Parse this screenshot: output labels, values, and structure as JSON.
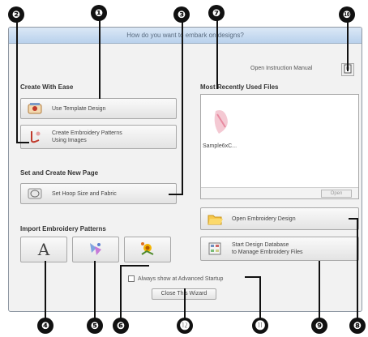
{
  "window": {
    "title": "How do you want to embark on designs?"
  },
  "left": {
    "create_with_ease": {
      "title": "Create With Ease",
      "template_button": "Use Template Design",
      "pattern_button_line1": "Create Embroidery Patterns",
      "pattern_button_line2": "Using Images"
    },
    "set_page": {
      "title": "Set and Create New Page",
      "page_button": "Set Hoop Size and Fabric"
    },
    "import": {
      "title": "Import Embroidery Patterns",
      "font_icon_glyph": "A"
    }
  },
  "right": {
    "manual_label": "Open Instruction Manual",
    "recent": {
      "title": "Most Recently Used Files",
      "files": [
        "Sample6xC..."
      ],
      "open_label": "Open"
    },
    "open_design_button": "Open Embroidery Design",
    "database_line1": "Start Design Database",
    "database_line2": "to Manage Embroidery Files"
  },
  "footer": {
    "checkbox_label": "Always show at Advanced Startup",
    "close_button": "Close This Wizard"
  },
  "callouts": {
    "c1": "❶",
    "c2": "❷",
    "c3": "❸",
    "c4": "❹",
    "c5": "❺",
    "c6": "❻",
    "c7": "❼",
    "c8": "❽",
    "c9": "❾",
    "c10": "❿",
    "c11": "⓫",
    "c12": "⓬"
  },
  "colors": {
    "titlebar": "#c9dcf1",
    "window_bg": "#f2f2f2",
    "callout": "#111111"
  }
}
